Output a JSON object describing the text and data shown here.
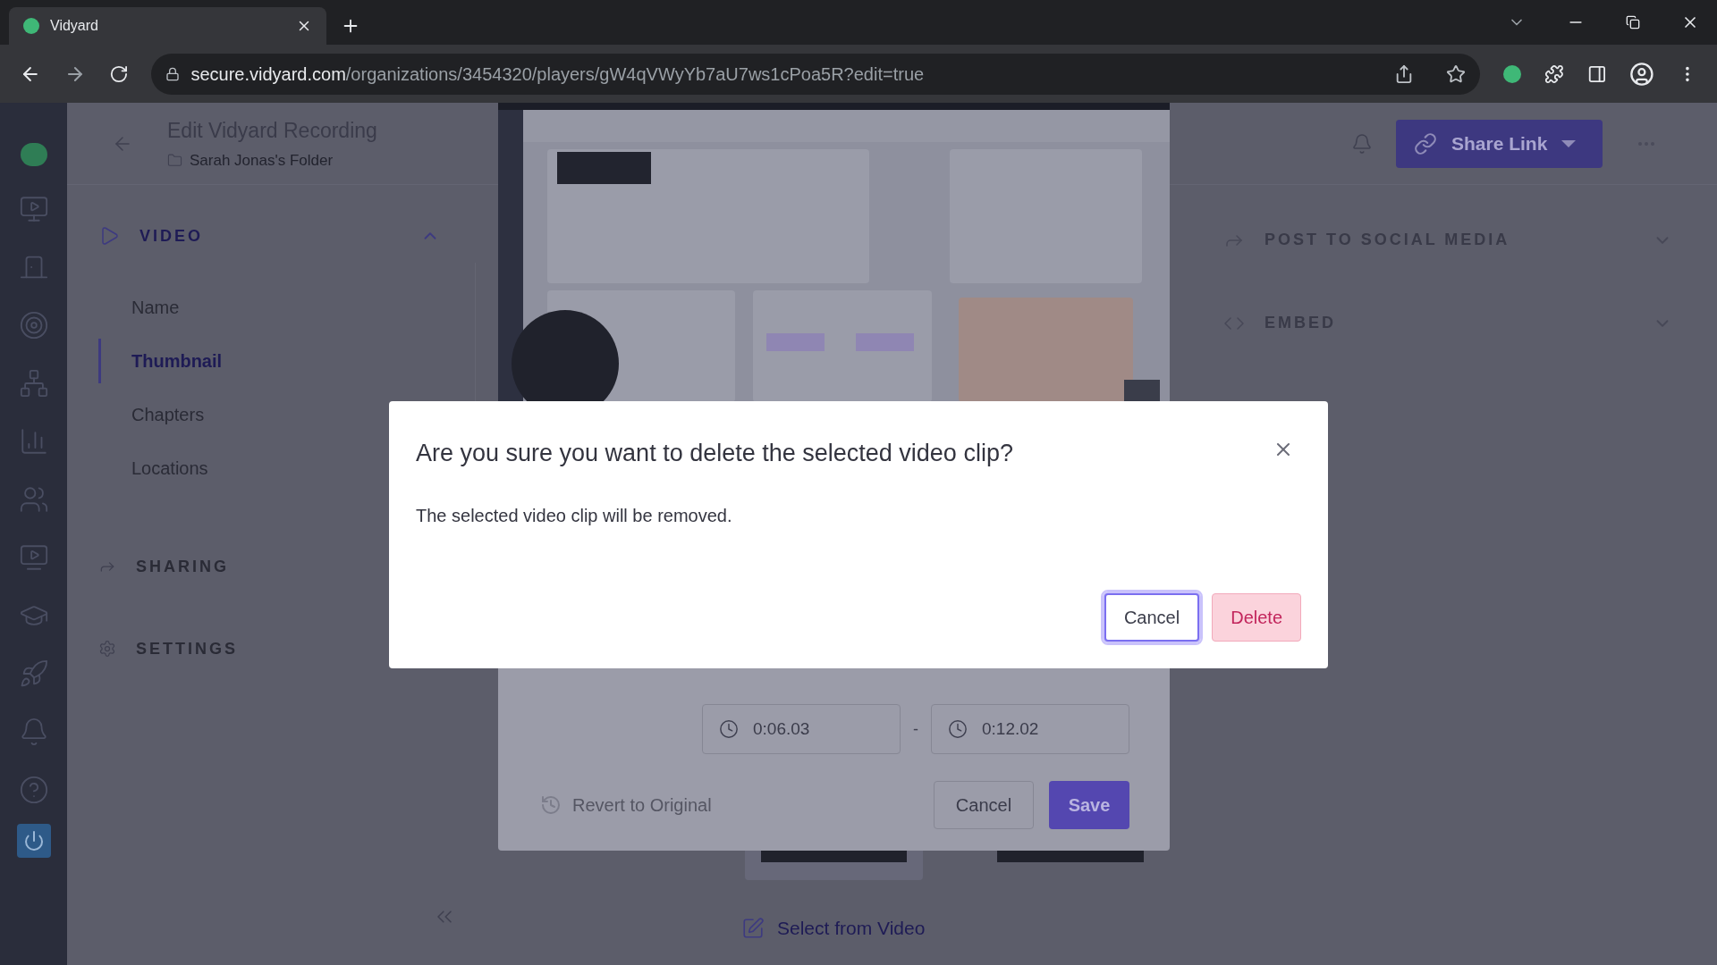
{
  "browser": {
    "tab_title": "Vidyard",
    "url_host": "secure.vidyard.com",
    "url_path": "/organizations/3454320/players/gW4qVWyYb7aU7ws1cPoa5R?edit=true"
  },
  "header": {
    "title": "Edit Vidyard Recording",
    "folder": "Sarah Jonas's Folder"
  },
  "nav": [
    {
      "label": "VIDEO",
      "kind": "video",
      "expanded": true,
      "items": [
        {
          "label": "Name",
          "selected": false
        },
        {
          "label": "Thumbnail",
          "selected": true
        },
        {
          "label": "Chapters",
          "selected": false
        },
        {
          "label": "Locations",
          "selected": false
        }
      ]
    },
    {
      "label": "SHARING",
      "kind": "sharing"
    },
    {
      "label": "SETTINGS",
      "kind": "settings"
    }
  ],
  "editor": {
    "times": [
      "0:06.03",
      "0:12.02"
    ],
    "separator": "-",
    "revert": "Revert to Original",
    "cancel": "Cancel",
    "save": "Save"
  },
  "select_from_video": "Select from Video",
  "share_button": "Share Link",
  "right_sections": [
    {
      "label": "POST TO SOCIAL MEDIA",
      "kind": "share"
    },
    {
      "label": "EMBED",
      "kind": "embed"
    }
  ],
  "dialog": {
    "title": "Are you sure you want to delete the selected video clip?",
    "message": "The selected video clip will be removed.",
    "buttons": [
      {
        "label": "Cancel",
        "kind": "secondary",
        "focused": true
      },
      {
        "label": "Delete",
        "kind": "danger",
        "focused": false
      }
    ]
  }
}
